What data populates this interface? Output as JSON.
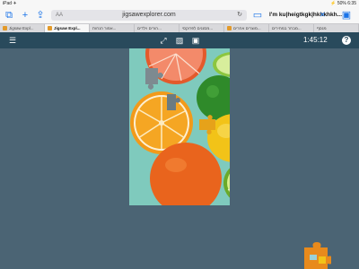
{
  "status": {
    "left": "iPad ✈",
    "right": "⚡ 50% 6:35"
  },
  "browser": {
    "url": "jigsawexplorer.com",
    "aa": "AA",
    "page_title": "I'm ku|heigtkgk|hkhkhkh...",
    "tabs": [
      {
        "label": "Jigsaw Expl..."
      },
      {
        "label": "Jigsaw Expl..."
      },
      {
        "label": "אמור הנחות..."
      },
      {
        "label": "הורים וילדים..."
      },
      {
        "label": "מסננים לפרוקסי..."
      },
      {
        "label": "מוצרים אחרים..."
      },
      {
        "label": "מבחר במחירים..."
      },
      {
        "label": "מנסף"
      }
    ]
  },
  "app": {
    "timer": "1:45:12",
    "help": "?"
  },
  "colors": {
    "appbar": "#294a5c",
    "workspace": "#4b6474",
    "accent": "#1a73e8"
  }
}
